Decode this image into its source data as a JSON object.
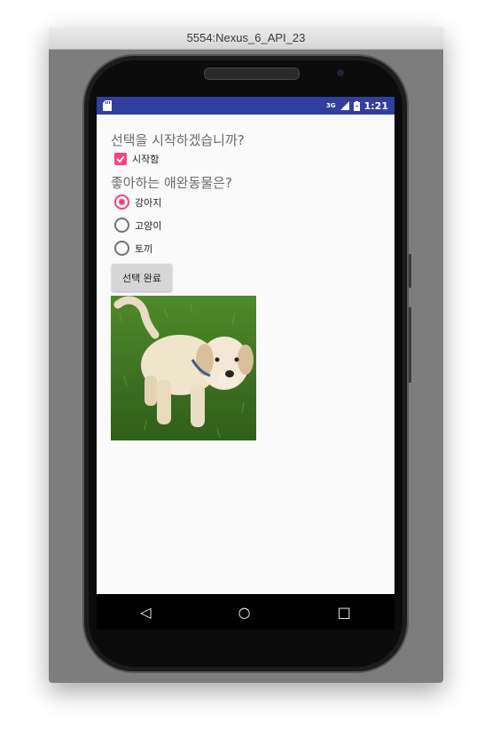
{
  "window": {
    "title": "5554:Nexus_6_API_23"
  },
  "statusbar": {
    "network": "3G",
    "time": "1:21"
  },
  "app": {
    "question1": "선택을 시작하겠습니까?",
    "start_checkbox": {
      "label": "시작함",
      "checked": true
    },
    "question2": "좋아하는 애완동물은?",
    "pets": [
      {
        "label": "강아지",
        "selected": true
      },
      {
        "label": "고양이",
        "selected": false
      },
      {
        "label": "토끼",
        "selected": false
      }
    ],
    "done_button": "선택 완료"
  },
  "navbar": {
    "back": "◁",
    "home": "○",
    "recents": "□"
  },
  "colors": {
    "statusbar": "#303f9f",
    "accent": "#ff4081"
  }
}
